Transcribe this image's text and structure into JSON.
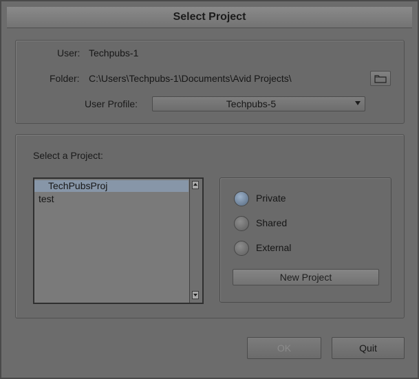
{
  "window": {
    "title": "Select Project"
  },
  "settings": {
    "user_label": "User:",
    "user_value": "Techpubs-1",
    "folder_label": "Folder:",
    "folder_value": "C:\\Users\\Techpubs-1\\Documents\\Avid Projects\\",
    "folder_browse_icon": "folder-icon",
    "profile_label": "User Profile:",
    "profile_value": "Techpubs-5"
  },
  "projects": {
    "label": "Select a Project:",
    "items": [
      {
        "name": "TechPubsProj",
        "selected": true
      },
      {
        "name": "test",
        "selected": false
      }
    ]
  },
  "project_type": {
    "options": [
      {
        "label": "Private",
        "checked": true
      },
      {
        "label": "Shared",
        "checked": false
      },
      {
        "label": "External",
        "checked": false
      }
    ],
    "new_project_label": "New Project"
  },
  "footer": {
    "ok_label": "OK",
    "quit_label": "Quit"
  },
  "colors": {
    "background": "#6c6c6c",
    "selection": "#8796a8",
    "radio_checked": "#7d92aa"
  }
}
